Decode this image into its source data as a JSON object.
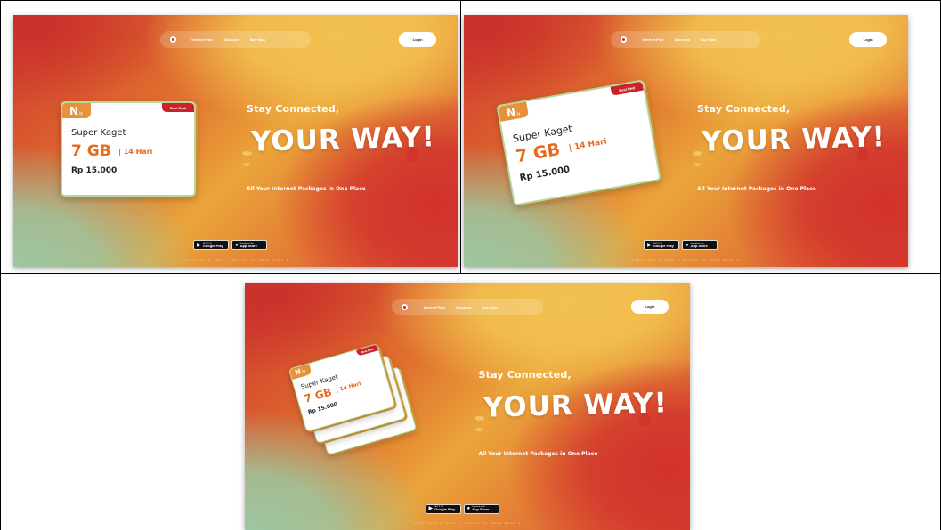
{
  "site": {
    "nav_items": [
      "Internet Plan",
      "Discount",
      "Buy Now"
    ],
    "login_label": "Login",
    "hero_subtitle": "Stay Connected,",
    "hero_title": "YOUR WAY!",
    "hero_description": "All Your Internet Packages in One Place",
    "google_play_small": "GET IT ON",
    "google_play_label": "Google Play",
    "app_store_small": "Download on the",
    "app_store_label": "App Store",
    "copyright": "Copyright © 2023 | Design by Made With ❤"
  },
  "card": {
    "logo_letter": "N",
    "logo_suffix": ".ly",
    "badge": "Best Deal",
    "name": "Super Kaget",
    "size": "7 GB",
    "period": "| 14 Hari",
    "price": "Rp 15.000"
  },
  "colors": {
    "accent_orange": "#e56b1f",
    "badge_red": "#c9232a",
    "card_border_green": "#b7d79d"
  }
}
